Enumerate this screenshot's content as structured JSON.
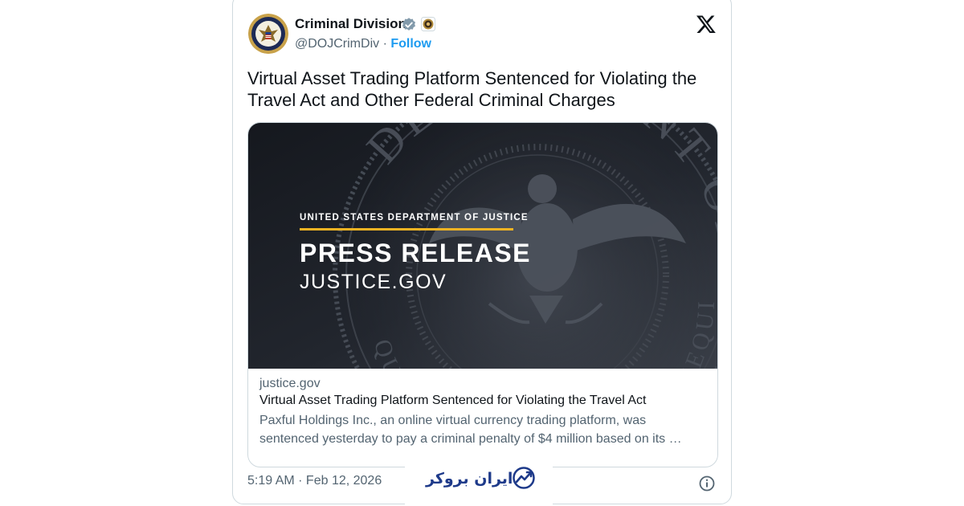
{
  "tweet": {
    "author": {
      "display_name": "Criminal Division",
      "handle": "@DOJCrimDiv",
      "separator": " · ",
      "follow_label": "Follow"
    },
    "text": "Virtual Asset Trading Platform Sentenced for Violating the Travel Act and Other Federal Criminal Charges",
    "link_card": {
      "image": {
        "org_line": "UNITED STATES DEPARTMENT OF JUSTICE",
        "headline": "PRESS RELEASE",
        "site": "JUSTICE.GOV",
        "seal_text_top": "DEPARTMENT OF JUSTICE",
        "seal_text_bottom": "QUI PRO DOMINA JUSTITIA SEQUITUR"
      },
      "domain": "justice.gov",
      "title": "Virtual Asset Trading Platform Sentenced for Violating the Travel Act",
      "description": "Paxful Holdings Inc., an online virtual currency trading platform, was sentenced yesterday to pay a criminal penalty of $4 million based on its …"
    },
    "timestamp": "5:19 AM · Feb 12, 2026"
  },
  "watermark": {
    "text": "ایران بروکر"
  },
  "icons": {
    "verified": "verified-badge-icon",
    "affiliate": "affiliate-badge-icon",
    "platform": "x-logo-icon",
    "info": "info-icon"
  },
  "colors": {
    "accent": "#1d9bf0",
    "secondary_text": "#536471",
    "border": "#cfd9de",
    "image_bg": "#1b1f26",
    "gold_rule": "#f0b323",
    "watermark": "#1e3a8a"
  }
}
